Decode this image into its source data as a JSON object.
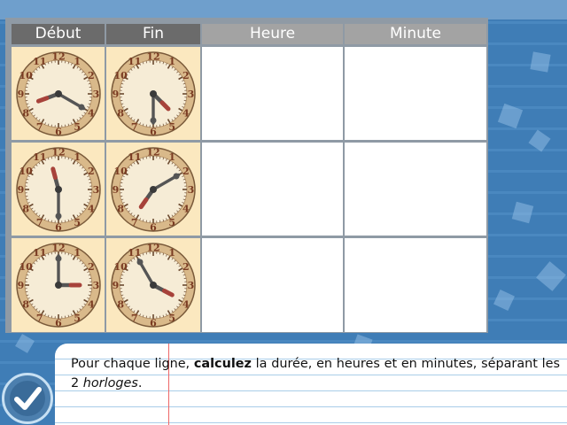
{
  "table": {
    "headers": [
      "Début",
      "Fin",
      "Heure",
      "Minute"
    ],
    "rows": [
      {
        "debut": {
          "hour": 8,
          "minute": 20
        },
        "fin": {
          "hour": 4,
          "minute": 30
        },
        "heure": "",
        "minute": ""
      },
      {
        "debut": {
          "hour": 11,
          "minute": 30
        },
        "fin": {
          "hour": 7,
          "minute": 10
        },
        "heure": "",
        "minute": ""
      },
      {
        "debut": {
          "hour": 3,
          "minute": 0
        },
        "fin": {
          "hour": 3,
          "minute": 55
        },
        "heure": "",
        "minute": ""
      }
    ]
  },
  "clock_numbers": [
    "12",
    "1",
    "2",
    "3",
    "4",
    "5",
    "6",
    "7",
    "8",
    "9",
    "10",
    "11"
  ],
  "instruction": {
    "text_1": "Pour chaque ligne, ",
    "bold": "calculez",
    "text_2": " la durée, en heures et en minutes, séparant les 2 ",
    "italic": "horloges",
    "text_3": "."
  },
  "check_button": {
    "icon": "checkmark-icon"
  },
  "colors": {
    "background": "#3f7db6",
    "header_dark": "#6b6b6b",
    "header_light": "#a3a3a3",
    "clock_cell": "#fbe8bf",
    "clock_number": "#7a3b22",
    "hour_hand_tip": "#a7423a"
  }
}
